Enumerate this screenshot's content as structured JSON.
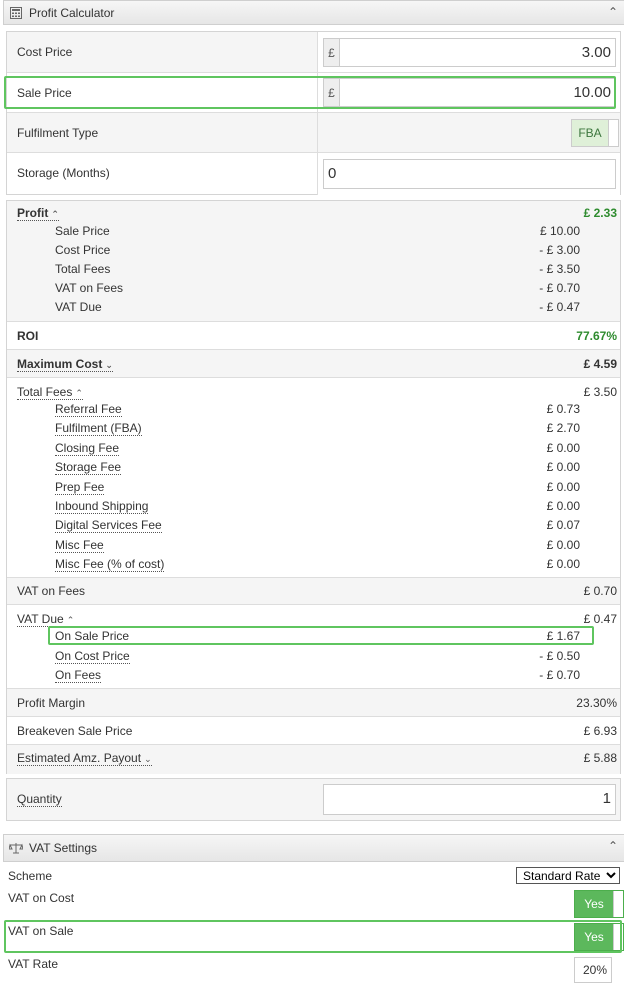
{
  "profit_panel": {
    "title": "Profit Calculator",
    "icon": "calculator-icon"
  },
  "inputs": {
    "cost_price_label": "Cost Price",
    "cost_price_value": "3.00",
    "sale_price_label": "Sale Price",
    "sale_price_value": "10.00",
    "currency_symbol": "£",
    "fulfilment_label": "Fulfilment Type",
    "fulfilment_value": "FBA",
    "storage_label": "Storage (Months)",
    "storage_value": "0"
  },
  "profit": {
    "label": "Profit",
    "value": "£ 2.33",
    "breakdown": [
      {
        "label": "Sale Price",
        "value": "£ 10.00"
      },
      {
        "label": "Cost Price",
        "value": "- £ 3.00"
      },
      {
        "label": "Total Fees",
        "value": "- £ 3.50"
      },
      {
        "label": "VAT on Fees",
        "value": "- £ 0.70"
      },
      {
        "label": "VAT Due",
        "value": "- £ 0.47"
      }
    ]
  },
  "roi": {
    "label": "ROI",
    "value": "77.67%"
  },
  "max_cost": {
    "label": "Maximum Cost",
    "value": "£ 4.59"
  },
  "total_fees": {
    "label": "Total Fees",
    "value": "£ 3.50",
    "items": [
      {
        "label": "Referral Fee",
        "value": "£ 0.73"
      },
      {
        "label": "Fulfilment (FBA)",
        "value": "£ 2.70"
      },
      {
        "label": "Closing Fee",
        "value": "£ 0.00"
      },
      {
        "label": "Storage Fee",
        "value": "£ 0.00"
      },
      {
        "label": "Prep Fee",
        "value": "£ 0.00"
      },
      {
        "label": "Inbound Shipping",
        "value": "£ 0.00"
      },
      {
        "label": "Digital Services Fee",
        "value": "£ 0.07"
      },
      {
        "label": "Misc Fee",
        "value": "£ 0.00"
      },
      {
        "label": "Misc Fee (% of cost)",
        "value": "£ 0.00"
      }
    ]
  },
  "vat_on_fees": {
    "label": "VAT on Fees",
    "value": "£ 0.70"
  },
  "vat_due": {
    "label": "VAT Due",
    "value": "£ 0.47",
    "items": [
      {
        "label": "On Sale Price",
        "value": "£ 1.67"
      },
      {
        "label": "On Cost Price",
        "value": "- £ 0.50"
      },
      {
        "label": "On Fees",
        "value": "- £ 0.70"
      }
    ]
  },
  "profit_margin": {
    "label": "Profit Margin",
    "value": "23.30%"
  },
  "breakeven": {
    "label": "Breakeven Sale Price",
    "value": "£ 6.93"
  },
  "payout": {
    "label": "Estimated Amz. Payout",
    "value": "£ 5.88"
  },
  "quantity": {
    "label": "Quantity",
    "value": "1"
  },
  "vat_panel": {
    "title": "VAT Settings",
    "icon": "scale-icon",
    "scheme_label": "Scheme",
    "scheme_value": "Standard Rate",
    "vat_on_cost_label": "VAT on Cost",
    "vat_on_cost_value": "Yes",
    "vat_on_sale_label": "VAT on Sale",
    "vat_on_sale_value": "Yes",
    "vat_rate_label": "VAT Rate",
    "vat_rate_value": "20%"
  },
  "colors": {
    "highlight": "#5fc55f",
    "positive": "#2e8b2e",
    "toggle_on": "#5cb85c"
  }
}
